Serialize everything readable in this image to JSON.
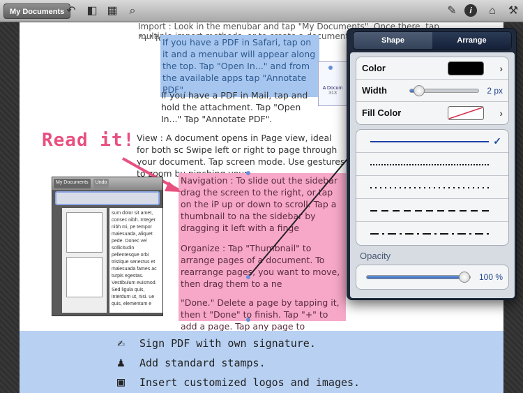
{
  "toolbar": {
    "my_documents_label": "My Documents",
    "icons": [
      "undo-icon",
      "sidebar-icon",
      "grid-icon",
      "search-icon",
      "pen-icon",
      "info-icon",
      "library-icon",
      "wrench-icon"
    ]
  },
  "document": {
    "top_line": "Import : Look in the menubar and tap \"My Documents\". Once there, tap \"+\" for",
    "top_line2": "multiple import methods, or to create a document from scratch.",
    "safari_para": "If you have a PDF in Safari, tap on it and a menubar will appear along the top. Tap \"Open In...\" and from the available apps tap \"Annotate PDF\".",
    "mail_para": "If you have a PDF in Mail, tap and hold the attachment. Tap \"Open In...\" Tap \"Annotate PDF\".",
    "view_para": "View : A document opens in Page view, ideal for both sc Swipe left or right to page through your document. Tap screen mode. Use gestures to zoom by pinching your",
    "nav_para": "Navigation : To slide out the sidebar drag the screen to the right, or tap on the iP up or down to scroll. Tap a thumbnail to na the sidebar by dragging it left with a finge",
    "organize_para": "Organize : Tap \"Thumbnail\" to arrange pages of a document. To rearrange pages, you want to move, then drag them to a ne",
    "done_para": "\"Done.\" Delete a page by tapping it, then t \"Done\" to finish. Tap \"+\" to add a page. Tap any page to navigate to it. If you change your mind, tap \"Undo\".",
    "read_it": "Read it!",
    "thumb_label": "A Docum",
    "thumb_sub": "313",
    "mini_buttons": [
      "My Documents",
      "Undo"
    ],
    "mini_text": "sum dolor sit amet, consec nibh. Integer nibh mi, pe tempor malesuada, aliquet pede. Donec vel sollicitudin pellentesque orbi tristique senectus et malesuada fames ac turpis egestas. Vestibulum euismod. Sed ligula quis, interdum ut, nisi. ue quis, elementum e"
  },
  "features": [
    {
      "icon": "signature-icon",
      "label": "Sign PDF with own signature."
    },
    {
      "icon": "stamp-icon",
      "label": "Add standard stamps."
    },
    {
      "icon": "image-icon",
      "label": "Insert customized logos and images."
    }
  ],
  "popover": {
    "tabs": [
      "Shape",
      "Arrange"
    ],
    "selected_tab": "Shape",
    "color_label": "Color",
    "color_value": "#000000",
    "width_label": "Width",
    "width_value": "2 px",
    "width_fraction": 0.06,
    "fill_label": "Fill Color",
    "line_styles": [
      "solid",
      "fine-dot",
      "dot",
      "dash",
      "dash-dot"
    ],
    "selected_line_style": "solid",
    "opacity_label": "Opacity",
    "opacity_value": "100 %",
    "opacity_fraction": 1.0
  },
  "colors": {
    "highlight_blue": "#a7c6ef",
    "highlight_pink": "#f7a8c8",
    "accent_pink": "#e8507f",
    "band_blue": "#b8d1f2",
    "line_blue": "#1c3fa8"
  }
}
